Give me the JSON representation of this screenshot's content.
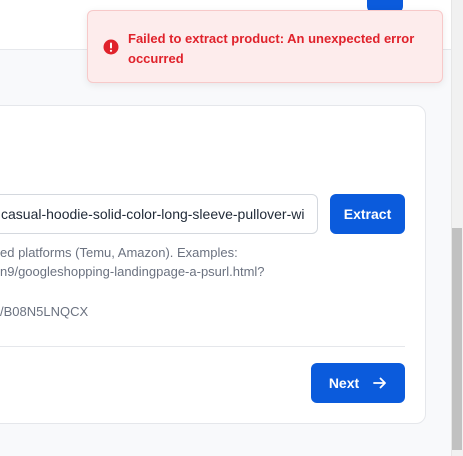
{
  "toast": {
    "message": "Failed to extract product: An unexpected error occurred",
    "icon": "error-circle-icon",
    "color": "#e0222b"
  },
  "form": {
    "url_value": "casual-hoodie-solid-color-long-sleeve-pullover-wi",
    "extract_label": "Extract",
    "help_lines": [
      "ed platforms (Temu, Amazon). Examples:",
      "n9/googleshopping-landingpage-a-psurl.html?",
      "/B08N5LNQCX"
    ],
    "next_label": "Next",
    "next_icon": "arrow-right-icon"
  },
  "colors": {
    "primary": "#0b5bdc",
    "error": "#e0222b",
    "toast_bg": "#fdecec"
  }
}
